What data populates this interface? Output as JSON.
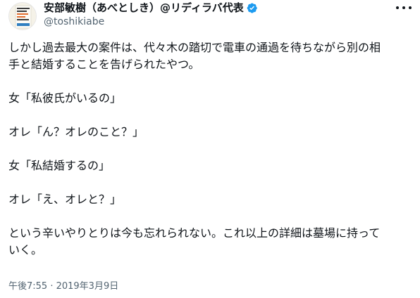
{
  "author": {
    "display_name": "安部敏樹（あべとしき）@リディラバ代表",
    "handle": "@toshikiabe",
    "verified_color": "#1d9bf0"
  },
  "tweet": {
    "lines": [
      "しかし過去最大の案件は、代々木の踏切で電車の通過を待ちながら別の相",
      "手と結婚することを告げられたやつ。",
      "",
      "女「私彼氏がいるの」",
      "",
      "オレ「ん？オレのこと？」",
      "",
      "女「私結婚するの」",
      "",
      "オレ「え、オレと？」",
      "",
      "という辛いやりとりは今も忘れられない。これ以上の詳細は墓場に持って",
      "いく。"
    ],
    "timestamp": "午後7:55 · 2019年3月9日"
  },
  "icons": {
    "avatar": "book-cover-avatar",
    "verified": "verified-badge-icon",
    "more": "more-options-icon"
  }
}
